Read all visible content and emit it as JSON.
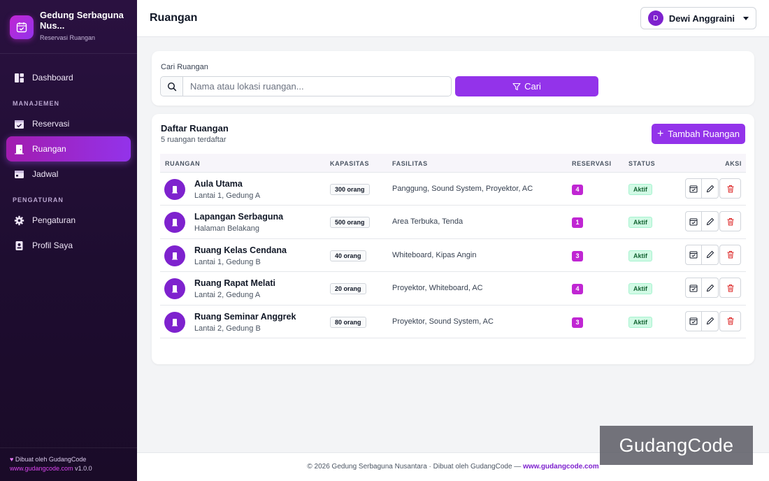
{
  "brand": {
    "name_line1": "Gedung Serbaguna",
    "name_line2": "Nus...",
    "subtitle": "Reservasi Ruangan"
  },
  "sidebar": {
    "dashboard": "Dashboard",
    "section_manajemen": "MANAJEMEN",
    "reservasi": "Reservasi",
    "ruangan": "Ruangan",
    "jadwal": "Jadwal",
    "section_pengaturan": "PENGATURAN",
    "pengaturan": "Pengaturan",
    "profil": "Profil Saya",
    "footer_line1": "Dibuat oleh GudangCode",
    "footer_link": "www.gudangcode.com",
    "footer_version": "v1.0.0"
  },
  "header": {
    "title": "Ruangan",
    "user_initial": "D",
    "user_name": "Dewi Anggraini"
  },
  "search": {
    "label": "Cari Ruangan",
    "placeholder": "Nama atau lokasi ruangan...",
    "button": "Cari"
  },
  "list": {
    "title": "Daftar Ruangan",
    "subtitle": "5 ruangan terdaftar",
    "add_button": "Tambah Ruangan",
    "columns": {
      "ruangan": "RUANGAN",
      "kapasitas": "KAPASITAS",
      "fasilitas": "FASILITAS",
      "reservasi": "RESERVASI",
      "status": "STATUS",
      "aksi": "AKSI"
    },
    "rows": [
      {
        "name": "Aula Utama",
        "location": "Lantai 1, Gedung A",
        "capacity": "300 orang",
        "facilities": "Panggung, Sound System, Proyektor, AC",
        "reservations": "4",
        "status": "Aktif"
      },
      {
        "name": "Lapangan Serbaguna",
        "location": "Halaman Belakang",
        "capacity": "500 orang",
        "facilities": "Area Terbuka, Tenda",
        "reservations": "1",
        "status": "Aktif"
      },
      {
        "name": "Ruang Kelas Cendana",
        "location": "Lantai 1, Gedung B",
        "capacity": "40 orang",
        "facilities": "Whiteboard, Kipas Angin",
        "reservations": "3",
        "status": "Aktif"
      },
      {
        "name": "Ruang Rapat Melati",
        "location": "Lantai 2, Gedung A",
        "capacity": "20 orang",
        "facilities": "Proyektor, Whiteboard, AC",
        "reservations": "4",
        "status": "Aktif"
      },
      {
        "name": "Ruang Seminar Anggrek",
        "location": "Lantai 2, Gedung B",
        "capacity": "80 orang",
        "facilities": "Proyektor, Sound System, AC",
        "reservations": "3",
        "status": "Aktif"
      }
    ]
  },
  "footer": {
    "text": "© 2026 Gedung Serbaguna Nusantara · Dibuat oleh GudangCode —",
    "link": "www.gudangcode.com"
  },
  "watermark": "GudangCode",
  "icons": {
    "brand": "calendar-check-icon",
    "dashboard": "dashboard-icon",
    "reservasi": "calendar-check-icon",
    "ruangan": "door-icon",
    "jadwal": "calendar-icon",
    "pengaturan": "gear-icon",
    "profil": "id-badge-icon",
    "search": "search-icon",
    "filter": "filter-icon",
    "add": "plus-icon",
    "row_actions": [
      "calendar-icon",
      "pencil-icon",
      "trash-icon"
    ]
  },
  "colors": {
    "primary": "#9333ea",
    "accent": "#c026d3",
    "sidebar": "#24103a",
    "success_bg": "#d1fae5",
    "success_text": "#166534",
    "danger": "#dc2626"
  }
}
